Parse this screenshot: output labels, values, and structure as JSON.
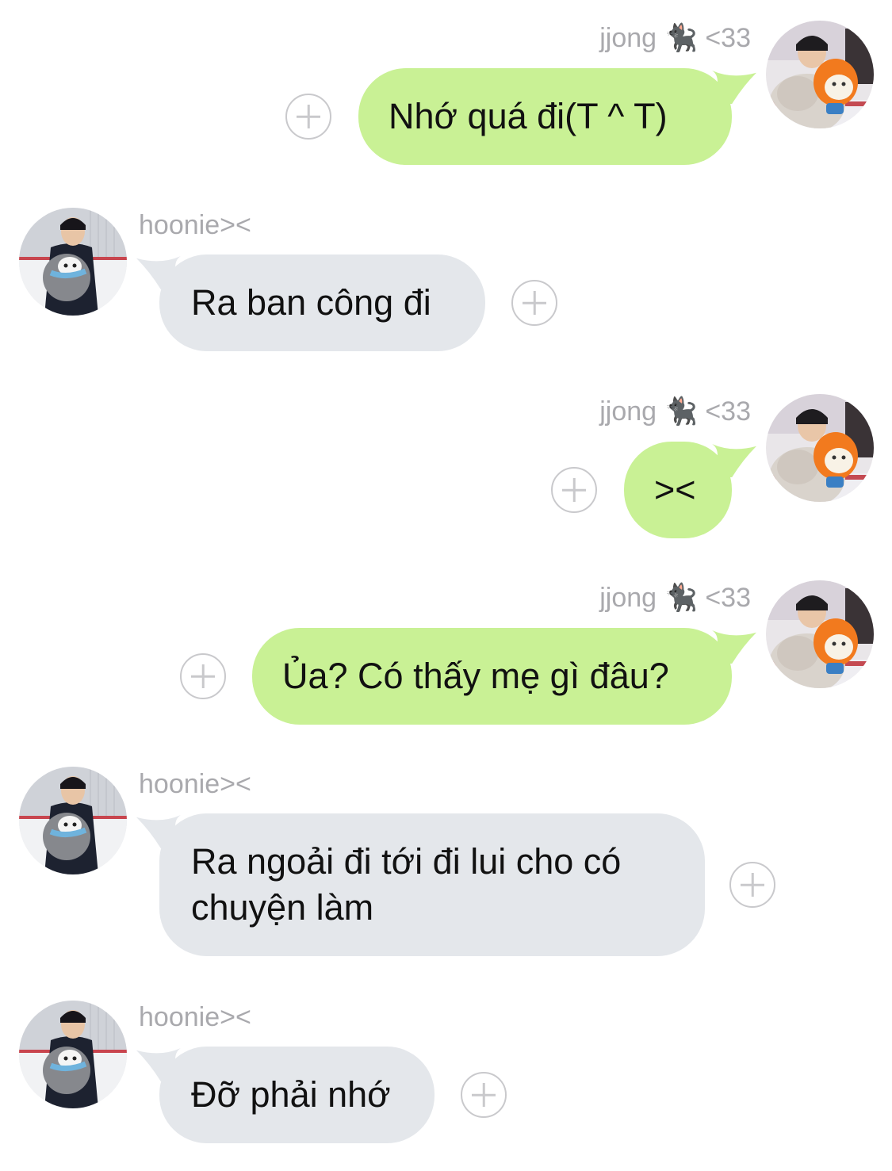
{
  "conversation": {
    "messages": [
      {
        "direction": "outgoing",
        "sender": "jjong",
        "sender_emoji": "🐈‍⬛",
        "sender_suffix": "<33",
        "text": "Nhớ quá đi(T ^ T)",
        "avatar": "jjong-avatar"
      },
      {
        "direction": "incoming",
        "sender": "hoonie><",
        "text": "Ra ban công đi",
        "avatar": "hoonie-avatar"
      },
      {
        "direction": "outgoing",
        "sender": "jjong",
        "sender_emoji": "🐈‍⬛",
        "sender_suffix": "<33",
        "text": "><",
        "avatar": "jjong-avatar"
      },
      {
        "direction": "outgoing",
        "sender": "jjong",
        "sender_emoji": "🐈‍⬛",
        "sender_suffix": "<33",
        "text": "Ủa? Có thấy mẹ gì đâu?",
        "avatar": "jjong-avatar"
      },
      {
        "direction": "incoming",
        "sender": "hoonie><",
        "text": "Ra ngoải đi tới đi lui cho có chuyện làm",
        "avatar": "hoonie-avatar"
      },
      {
        "direction": "incoming",
        "sender": "hoonie><",
        "text": "Đỡ phải nhớ",
        "avatar": "hoonie-avatar"
      }
    ]
  },
  "colors": {
    "outgoing_bubble": "#c9f195",
    "incoming_bubble": "#e4e7eb",
    "sender_name": "#a9a9ad",
    "add_icon": "#c9c9cc"
  },
  "icons": {
    "add_reaction": "plus-circle-icon",
    "sender_emoji": "black-cat-emoji"
  }
}
